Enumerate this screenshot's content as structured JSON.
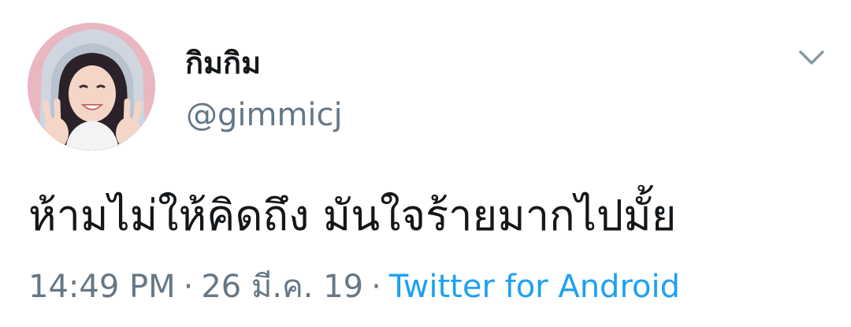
{
  "tweet": {
    "author": {
      "display_name": "กิมกิม",
      "handle": "@gimmicj",
      "avatar_icon": "profile-photo"
    },
    "menu_icon": "chevron-down-icon",
    "text": "ห้ามไม่ให้คิดถึง มันใจร้ายมากไปมั้ย",
    "meta": {
      "time": "14:49 PM",
      "separator": "·",
      "date": "26 มี.ค. 19",
      "source": "Twitter for Android"
    }
  },
  "colors": {
    "text_primary": "#14171a",
    "text_secondary": "#657786",
    "link": "#1da1f2",
    "avatar_bg": "#e9b7c2"
  }
}
